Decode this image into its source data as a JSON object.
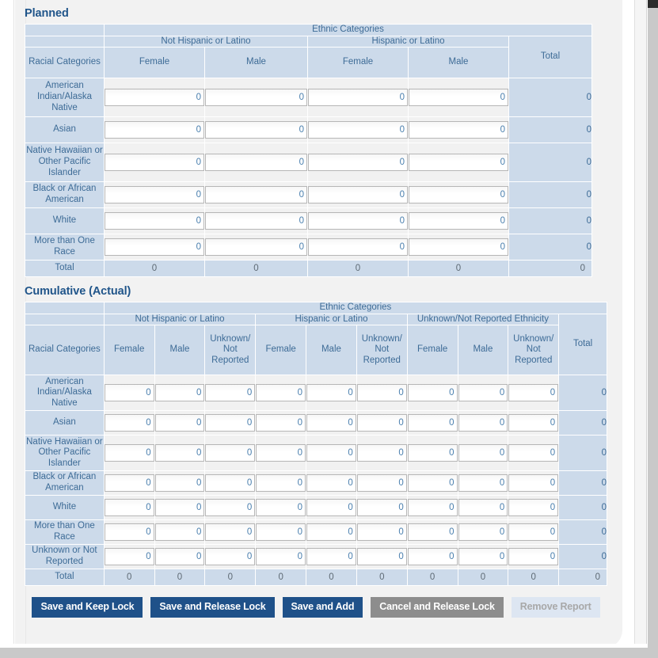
{
  "page": {
    "accent_color": "#1f5189",
    "header_bg": "#ccdaea",
    "cell_bg": "#f1f1f1",
    "label_color": "#3d6b96"
  },
  "planned": {
    "title": "Planned",
    "ethnic_categories_label": "Ethnic Categories",
    "racial_categories_label": "Racial Categories",
    "total_label": "Total",
    "ethnic_groups": [
      {
        "label": "Not Hispanic or Latino",
        "subcolumns": [
          "Female",
          "Male"
        ]
      },
      {
        "label": "Hispanic or Latino",
        "subcolumns": [
          "Female",
          "Male"
        ]
      }
    ],
    "subcolumns": [
      "Female",
      "Male",
      "Female",
      "Male"
    ],
    "rows": [
      {
        "label": "American Indian/Alaska Native",
        "values": [
          "0",
          "0",
          "0",
          "0"
        ],
        "total": "0"
      },
      {
        "label": "Asian",
        "values": [
          "0",
          "0",
          "0",
          "0"
        ],
        "total": "0"
      },
      {
        "label": "Native Hawaiian or Other Pacific Islander",
        "values": [
          "0",
          "0",
          "0",
          "0"
        ],
        "total": "0"
      },
      {
        "label": "Black or African American",
        "values": [
          "0",
          "0",
          "0",
          "0"
        ],
        "total": "0"
      },
      {
        "label": "White",
        "values": [
          "0",
          "0",
          "0",
          "0"
        ],
        "total": "0"
      },
      {
        "label": "More than One Race",
        "values": [
          "0",
          "0",
          "0",
          "0"
        ],
        "total": "0"
      }
    ],
    "total_row": {
      "label": "Total",
      "values": [
        "0",
        "0",
        "0",
        "0"
      ],
      "total": "0"
    }
  },
  "cumulative": {
    "title": "Cumulative (Actual)",
    "ethnic_categories_label": "Ethnic Categories",
    "racial_categories_label": "Racial Categories",
    "total_label": "Total",
    "ethnic_groups": [
      {
        "label": "Not Hispanic or Latino",
        "subcolumns": [
          "Female",
          "Male",
          "Unknown/ Not Reported"
        ]
      },
      {
        "label": "Hispanic or Latino",
        "subcolumns": [
          "Female",
          "Male",
          "Unknown/ Not Reported"
        ]
      },
      {
        "label": "Unknown/Not Reported Ethnicity",
        "subcolumns": [
          "Female",
          "Male",
          "Unknown/ Not Reported"
        ]
      }
    ],
    "subcolumns": [
      "Female",
      "Male",
      "Unknown/ Not Reported",
      "Female",
      "Male",
      "Unknown/ Not Reported",
      "Female",
      "Male",
      "Unknown/ Not Reported"
    ],
    "rows": [
      {
        "label": "American Indian/Alaska Native",
        "values": [
          "0",
          "0",
          "0",
          "0",
          "0",
          "0",
          "0",
          "0",
          "0"
        ],
        "total": "0"
      },
      {
        "label": "Asian",
        "values": [
          "0",
          "0",
          "0",
          "0",
          "0",
          "0",
          "0",
          "0",
          "0"
        ],
        "total": "0"
      },
      {
        "label": "Native Hawaiian or Other Pacific Islander",
        "values": [
          "0",
          "0",
          "0",
          "0",
          "0",
          "0",
          "0",
          "0",
          "0"
        ],
        "total": "0"
      },
      {
        "label": "Black or African American",
        "values": [
          "0",
          "0",
          "0",
          "0",
          "0",
          "0",
          "0",
          "0",
          "0"
        ],
        "total": "0"
      },
      {
        "label": "White",
        "values": [
          "0",
          "0",
          "0",
          "0",
          "0",
          "0",
          "0",
          "0",
          "0"
        ],
        "total": "0"
      },
      {
        "label": "More than One Race",
        "values": [
          "0",
          "0",
          "0",
          "0",
          "0",
          "0",
          "0",
          "0",
          "0"
        ],
        "total": "0"
      },
      {
        "label": "Unknown or Not Reported",
        "values": [
          "0",
          "0",
          "0",
          "0",
          "0",
          "0",
          "0",
          "0",
          "0"
        ],
        "total": "0"
      }
    ],
    "total_row": {
      "label": "Total",
      "values": [
        "0",
        "0",
        "0",
        "0",
        "0",
        "0",
        "0",
        "0",
        "0"
      ],
      "total": "0"
    }
  },
  "buttons": [
    {
      "label": "Save and Keep Lock",
      "style": "primary",
      "enabled": true,
      "name": "save-and-keep-lock-button"
    },
    {
      "label": "Save and Release Lock",
      "style": "primary",
      "enabled": true,
      "name": "save-and-release-lock-button"
    },
    {
      "label": "Save and Add",
      "style": "primary",
      "enabled": true,
      "name": "save-and-add-button"
    },
    {
      "label": "Cancel and Release Lock",
      "style": "gray",
      "enabled": true,
      "name": "cancel-and-release-lock-button"
    },
    {
      "label": "Remove Report",
      "style": "disabled",
      "enabled": false,
      "name": "remove-report-button"
    }
  ]
}
